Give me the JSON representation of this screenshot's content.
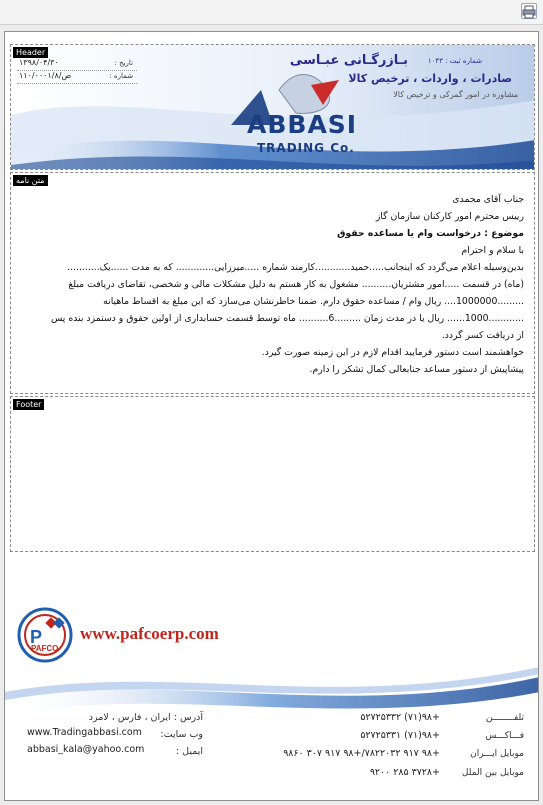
{
  "toolbar": {
    "print_icon": "printer-icon"
  },
  "bands": {
    "header": "Header",
    "body": "متن نامه",
    "footer": "Footer"
  },
  "company": {
    "name": "بـازرگـانی عبـاسی",
    "reg": "شماره ثبت : ۱۰۴۳",
    "line2": "صادرات ، واردات ، ترخیص کالا",
    "line3": "مشاوره در امور گمرکی و ترخیص کالا",
    "logo_main": "ABBASI",
    "logo_sub": "TRADING Co."
  },
  "meta": {
    "date_label": "تاریخ :",
    "date_value": "۱۳۹۸/۰۴/۳۰",
    "number_label": "شماره :",
    "number_value": "۱۱۰/۰۰۰۱/ص/۸"
  },
  "letter": {
    "salutation": "جناب آقای محمدی",
    "position": "رییس محترم امور کارکنان سازمان گاز",
    "subject": "موضوع : درخواست وام یا مساعده حقوق",
    "greeting": "با سلام و احترام",
    "line1": "بدین‌وسیله اعلام می‌گردد که اینجانب.....حمید............کارمند شماره .....میرزایی............. که به مدت ......یک...........",
    "line2": "(ماه) در قسمت .....امور مشتریان.......... مشغول به کار هستم به دلیل مشکلات مالی و شخصی، تقاضای دریافت مبلغ",
    "line3": ".........1000000.... ریال وام / مساعده حقوق دارم. ضمنا خاطرنشان می‌سازد که این مبلغ به اقساط ماهیانه",
    "line4": "............1000...... ریال یا در مدت زمان .........6.......... ماه توسط قسمت حسابداری از اولین حقوق و دستمزد بنده پس",
    "line5": "از دریافت کسر گردد.",
    "line6": "خواهشمند است دستور فرمایید اقدام لازم در این زمینه صورت گیرد.",
    "line7": "پیشاپیش از دستور مساعد جنابعالی کمال تشکر را دارم."
  },
  "footer": {
    "pafco_logo_text": "PAFCO",
    "pafco_url": "www.pafcoerp.com",
    "address_label": "آدرس : ایران ، فارس ، لامرد",
    "website_label": "وب سایت:",
    "website_value": "www.Tradingabbasi.com",
    "email_label": "ایمیل :",
    "email_value": "abbasi_kala@yahoo.com",
    "phone_label": "تلفــــــــن",
    "phone_value": "+۹۸(۷۱) ۵۲۷۲۵۳۳۲",
    "fax_label": "فـــاکـــس",
    "fax_value": "+۹۸(۷۱) ۵۲۷۲۵۳۳۱",
    "mobile_iran_label": "موبایل ایـــران",
    "mobile_iran_value": "+۹۸ ۹۱۷ ۷۸۲۲۰۳۲/+۹۸ ۹۱۷ ۳۰۷ ۹۸۶۰",
    "mobile_intl_label": "موبایل بین الملل",
    "mobile_intl_value": "+۳۷۲۸ ۲۸۵ ۹۲۰۰"
  },
  "colors": {
    "brand_blue": "#1b3d82",
    "pafco_red": "#c0261c",
    "wave_blue": "#3a78c4"
  }
}
